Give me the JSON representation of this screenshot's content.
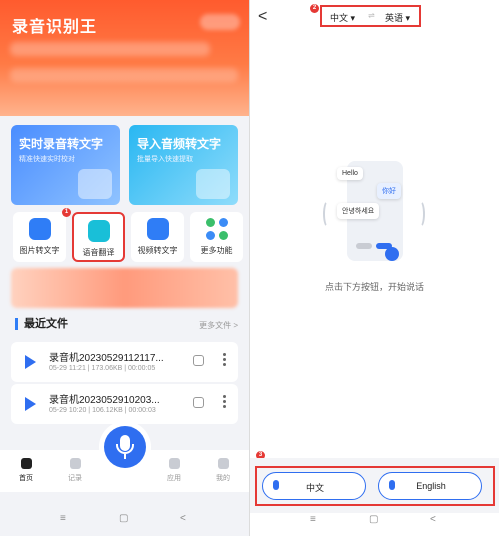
{
  "left_screen": {
    "app_title": "录音识别王",
    "cards": [
      {
        "title": "实时录音转文字",
        "subtitle": "精准快速实时校对"
      },
      {
        "title": "导入音频转文字",
        "subtitle": "批量导入快速提取"
      }
    ],
    "tools": [
      {
        "label": "图片转文字"
      },
      {
        "label": "语音翻译"
      },
      {
        "label": "视频转文字"
      },
      {
        "label": "更多功能"
      }
    ],
    "marker_1": "1",
    "recent_title": "最近文件",
    "more_files": "更多文件 >",
    "files": [
      {
        "name": "录音机20230529112117...",
        "meta": "05-29 11:21  |  173.06KB  |  00:00:05"
      },
      {
        "name": "录音机2023052910203...",
        "meta": "05-29 10:20  |  106.12KB  |  00:00:03"
      }
    ],
    "tabbar": [
      {
        "label": "首页",
        "active": true
      },
      {
        "label": "记录"
      },
      {
        "label": "应用"
      },
      {
        "label": "我的"
      }
    ],
    "nav": {
      "menu": "≡",
      "home": "▢",
      "back": "<"
    }
  },
  "right_screen": {
    "back": "<",
    "marker_2": "2",
    "source_lang": "中文 ▾",
    "swap": "⇌",
    "target_lang": "英语 ▾",
    "illustration": {
      "bubble_en": "Hello",
      "bubble_zh": "你好",
      "bubble_kr": "안녕하세요"
    },
    "hint": "点击下方按钮，开始说话",
    "marker_3": "3",
    "buttons": [
      {
        "label": "中文"
      },
      {
        "label": "English"
      }
    ],
    "nav": {
      "menu": "≡",
      "home": "▢",
      "back": "<"
    }
  },
  "colors": {
    "accent": "#2f6ef0",
    "highlight": "#e53935",
    "hero": "#ff5b2e"
  }
}
